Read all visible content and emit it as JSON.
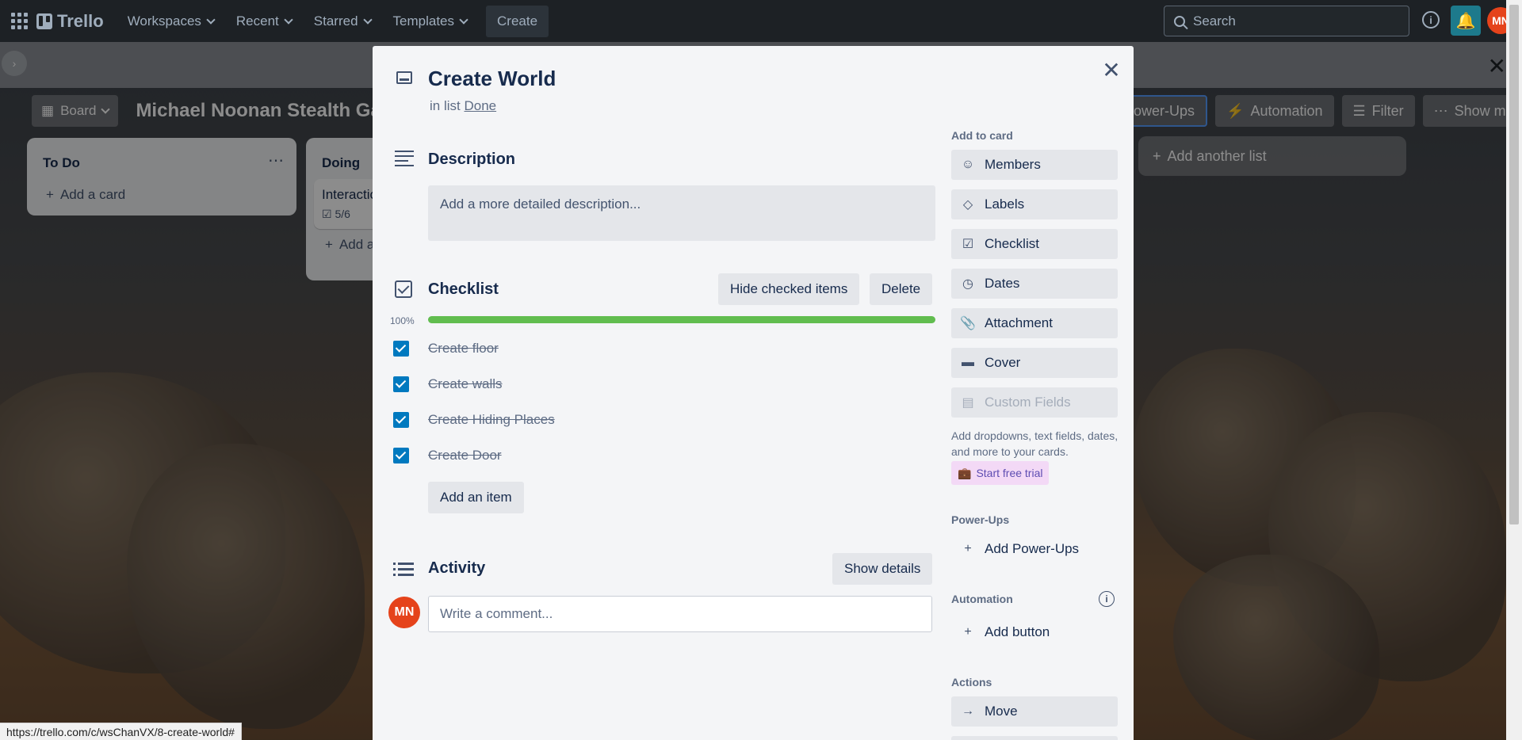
{
  "topnav": {
    "logo": "Trello",
    "items": [
      {
        "label": "Workspaces"
      },
      {
        "label": "Recent"
      },
      {
        "label": "Starred"
      },
      {
        "label": "Templates"
      }
    ],
    "create_label": "Create",
    "search_placeholder": "Search",
    "avatar_initials": "MN"
  },
  "board": {
    "view_label": "Board",
    "title": "Michael Noonan Stealth Game",
    "powerups_label": "Power-Ups",
    "automation_label": "Automation",
    "filter_label": "Filter",
    "show_menu_label": "Show menu",
    "add_list_label": "Add another list",
    "lists": [
      {
        "title": "To Do",
        "add_card": "Add a card"
      },
      {
        "title": "Doing",
        "card_title": "Interactions",
        "card_checklist": "5/6",
        "add_card": "Add a card"
      }
    ]
  },
  "card": {
    "title": "Create World",
    "in_list_prefix": "in list",
    "list_name": "Done",
    "description_heading": "Description",
    "description_placeholder": "Add a more detailed description...",
    "checklist": {
      "heading": "Checklist",
      "hide_checked_label": "Hide checked items",
      "delete_label": "Delete",
      "percent_label": "100%",
      "progress": 1.0,
      "items": [
        {
          "text": "Create floor",
          "checked": true
        },
        {
          "text": "Create walls",
          "checked": true
        },
        {
          "text": "Create Hiding Places",
          "checked": true
        },
        {
          "text": "Create Door",
          "checked": true
        }
      ],
      "add_item_label": "Add an item"
    },
    "activity": {
      "heading": "Activity",
      "show_details_label": "Show details",
      "avatar_initials": "MN",
      "comment_placeholder": "Write a comment..."
    }
  },
  "sidebar": {
    "add_to_card_heading": "Add to card",
    "add_to_card": [
      {
        "label": "Members",
        "icon": "person-icon"
      },
      {
        "label": "Labels",
        "icon": "tag-icon"
      },
      {
        "label": "Checklist",
        "icon": "checklist-icon"
      },
      {
        "label": "Dates",
        "icon": "clock-icon"
      },
      {
        "label": "Attachment",
        "icon": "paperclip-icon"
      },
      {
        "label": "Cover",
        "icon": "cover-icon"
      },
      {
        "label": "Custom Fields",
        "icon": "custom-fields-icon"
      }
    ],
    "custom_fields_note": "Add dropdowns, text fields, dates, and more to your cards.",
    "trial_label": "Start free trial",
    "powerups_heading": "Power-Ups",
    "add_powerups_label": "Add Power-Ups",
    "automation_heading": "Automation",
    "add_button_label": "Add button",
    "actions_heading": "Actions",
    "move_label": "Move"
  },
  "status_url": "https://trello.com/c/wsChanVX/8-create-world#"
}
